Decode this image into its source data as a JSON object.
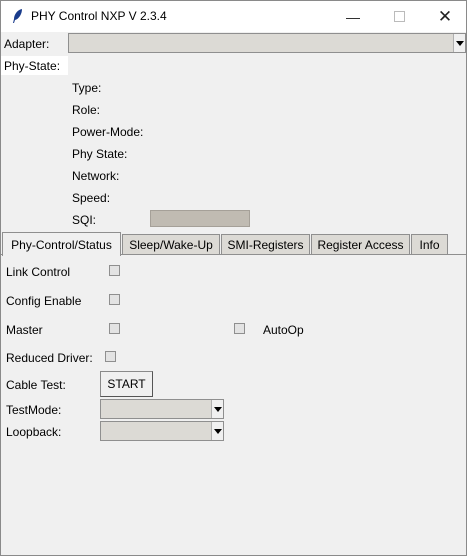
{
  "window": {
    "title": "PHY Control NXP V 2.3.4",
    "minimize_icon": "minimize-icon",
    "maximize_icon": "maximize-icon",
    "close_icon": "close-icon"
  },
  "adapter": {
    "label": "Adapter:",
    "value": ""
  },
  "phy_state": {
    "label": "Phy-State:",
    "fields": {
      "type": "Type:",
      "role": "Role:",
      "power_mode": "Power-Mode:",
      "phy_state": "Phy State:",
      "network": "Network:",
      "speed": "Speed:",
      "sqi": "SQI:"
    }
  },
  "tabs": [
    "Phy-Control/Status",
    "Sleep/Wake-Up",
    "SMI-Registers",
    "Register Access",
    "Info"
  ],
  "control": {
    "link_control": "Link Control",
    "config_enable": "Config Enable",
    "master": "Master",
    "autoop": "AutoOp",
    "reduced_driver": "Reduced Driver:",
    "cable_test": "Cable Test:",
    "start_button": "START",
    "testmode": "TestMode:",
    "loopback": "Loopback:"
  },
  "colors": {
    "accent_bar": "#c0bbb2",
    "combo_bg": "#dcdad5"
  }
}
